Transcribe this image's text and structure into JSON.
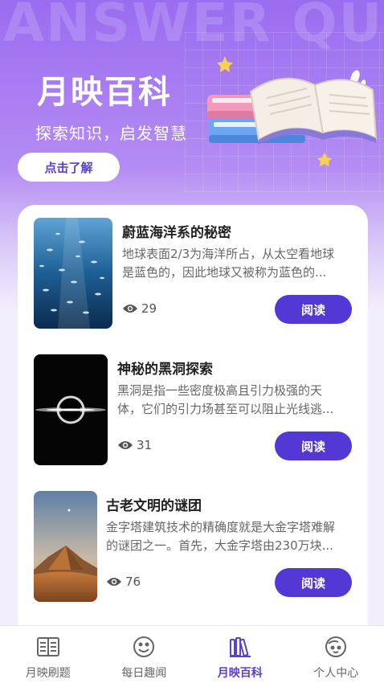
{
  "hero": {
    "watermark": "ANSWER QUE",
    "title": "月映百科",
    "subtitle": "探索知识，启发智慧",
    "cta_label": "点击了解"
  },
  "articles": [
    {
      "title": "蔚蓝海洋系的秘密",
      "desc_line1": "地球表面2/3为海洋所占，从太空看地球",
      "desc_line2": "是蓝色的，因此地球又被称为蓝色的...",
      "views": "29",
      "read_label": "阅读",
      "image": "ocean-fish-school"
    },
    {
      "title": "神秘的黑洞探索",
      "desc_line1": "黑洞是指一些密度极高且引力极强的天",
      "desc_line2": "体，它们的引力场甚至可以阻止光线逃...",
      "views": "31",
      "read_label": "阅读",
      "image": "black-hole"
    },
    {
      "title": "古老文明的谜团",
      "desc_line1": "金字塔建筑技术的精确度就是大金字塔难解",
      "desc_line2": "的谜团之一。首先，大金字塔由230万块...",
      "views": "76",
      "read_label": "阅读",
      "image": "desert-pyramid"
    }
  ],
  "tabs": [
    {
      "label": "月映刷题",
      "icon": "book-open-icon"
    },
    {
      "label": "每日趣闻",
      "icon": "smile-icon"
    },
    {
      "label": "月映百科",
      "icon": "books-icon",
      "active": true
    },
    {
      "label": "个人中心",
      "icon": "user-face-icon"
    }
  ],
  "colors": {
    "accent": "#5438d6",
    "hero_top": "#9a6cf0",
    "active_tab": "#5a3fd1"
  }
}
